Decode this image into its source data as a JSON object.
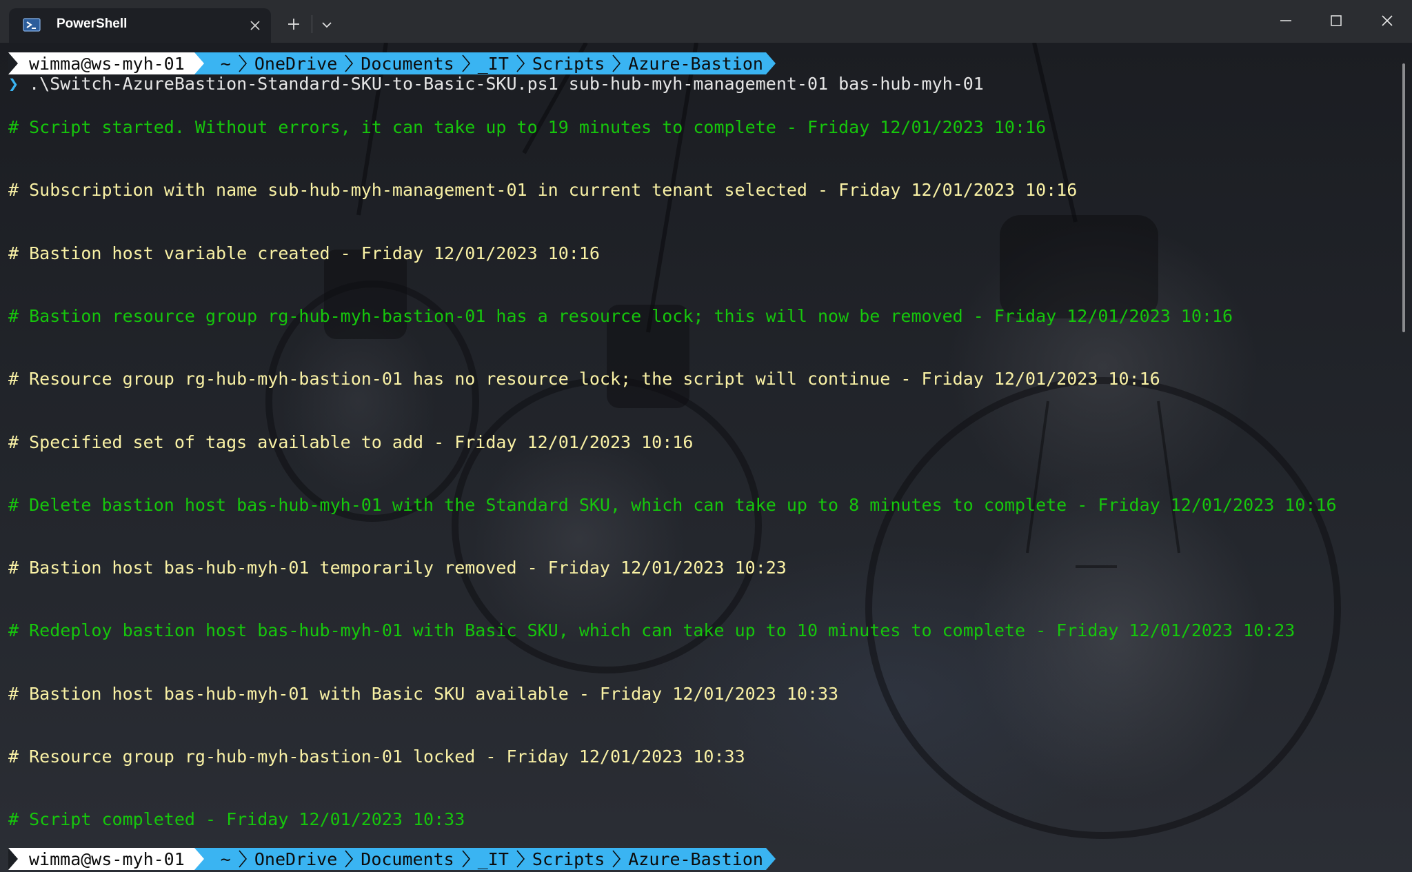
{
  "window": {
    "tab_title": "PowerShell",
    "icons": {
      "tab": "powershell-icon",
      "close_tab": "close-icon",
      "new_tab": "plus-icon",
      "dropdown": "chevron-down-icon",
      "minimize": "minimize-icon",
      "maximize": "maximize-icon",
      "close_window": "close-icon"
    }
  },
  "prompt": {
    "user": "wimma@ws-myh-01",
    "path": [
      "~",
      "OneDrive",
      "Documents",
      "_IT",
      "Scripts",
      "Azure-Bastion"
    ]
  },
  "command": {
    "caret": "❯",
    "text": ".\\Switch-AzureBastion-Standard-SKU-to-Basic-SKU.ps1 sub-hub-myh-management-01 bas-hub-myh-01"
  },
  "output": [
    {
      "text": "# Script started. Without errors, it can take up to 19 minutes to complete - Friday 12/01/2023 10:16",
      "color": "green"
    },
    {
      "text": "# Subscription with name sub-hub-myh-management-01 in current tenant selected - Friday 12/01/2023 10:16",
      "color": "yellow"
    },
    {
      "text": "# Bastion host variable created - Friday 12/01/2023 10:16",
      "color": "yellow"
    },
    {
      "text": "# Bastion resource group rg-hub-myh-bastion-01 has a resource lock; this will now be removed - Friday 12/01/2023 10:16",
      "color": "green"
    },
    {
      "text": "# Resource group rg-hub-myh-bastion-01 has no resource lock; the script will continue - Friday 12/01/2023 10:16",
      "color": "yellow"
    },
    {
      "text": "# Specified set of tags available to add - Friday 12/01/2023 10:16",
      "color": "yellow"
    },
    {
      "text": "# Delete bastion host bas-hub-myh-01 with the Standard SKU, which can take up to 8 minutes to complete - Friday 12/01/2023 10:16",
      "color": "green"
    },
    {
      "text": "# Bastion host bas-hub-myh-01 temporarily removed - Friday 12/01/2023 10:23",
      "color": "yellow"
    },
    {
      "text": "# Redeploy bastion host bas-hub-myh-01 with Basic SKU, which can take up to 10 minutes to complete - Friday 12/01/2023 10:23",
      "color": "green"
    },
    {
      "text": "# Bastion host bas-hub-myh-01 with Basic SKU available - Friday 12/01/2023 10:33",
      "color": "yellow"
    },
    {
      "text": "# Resource group rg-hub-myh-bastion-01 locked - Friday 12/01/2023 10:33",
      "color": "yellow"
    },
    {
      "text": "# Script completed - Friday 12/01/2023 10:33",
      "color": "green"
    }
  ],
  "colors": {
    "green": "#16c60c",
    "yellow": "#f9f1a5",
    "prompt_user_bg": "#ffffff",
    "prompt_path_bg": "#3ab4f2"
  }
}
